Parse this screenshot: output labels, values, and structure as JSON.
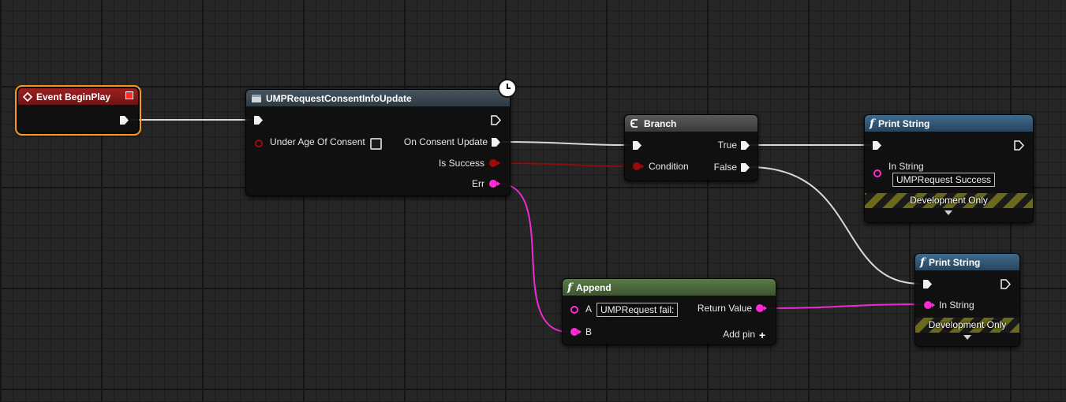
{
  "nodes": {
    "begin_play": {
      "title": "Event BeginPlay"
    },
    "consent_update": {
      "title": "UMPRequestConsentInfoUpdate",
      "pins": {
        "under_age": "Under Age Of Consent",
        "on_update": "On Consent Update",
        "is_success": "Is Success",
        "err": "Err"
      }
    },
    "branch": {
      "title": "Branch",
      "pins": {
        "condition": "Condition",
        "true": "True",
        "false": "False"
      }
    },
    "print_success": {
      "title": "Print String",
      "pins": {
        "in_string": "In String"
      },
      "in_string_value": "UMPRequest Success",
      "dev_only": "Development Only"
    },
    "append": {
      "title": "Append",
      "pins": {
        "a": "A",
        "b": "B",
        "return_value": "Return Value",
        "add_pin": "Add pin"
      },
      "a_value": "UMPRequest fail:"
    },
    "print_fail": {
      "title": "Print String",
      "pins": {
        "in_string": "In String"
      },
      "dev_only": "Development Only"
    }
  },
  "colors": {
    "exec_wire": "#d9d9d9",
    "bool_wire": "#8a0d0d",
    "string_wire": "#f02ad2",
    "event_header": "#8c1a1a",
    "latent_header": "#3a4a55",
    "branch_header": "#4b4b4b",
    "function_header": "#355a7a",
    "pure_function_header": "#4f6b3d",
    "selection_outline": "#f59a1e"
  }
}
